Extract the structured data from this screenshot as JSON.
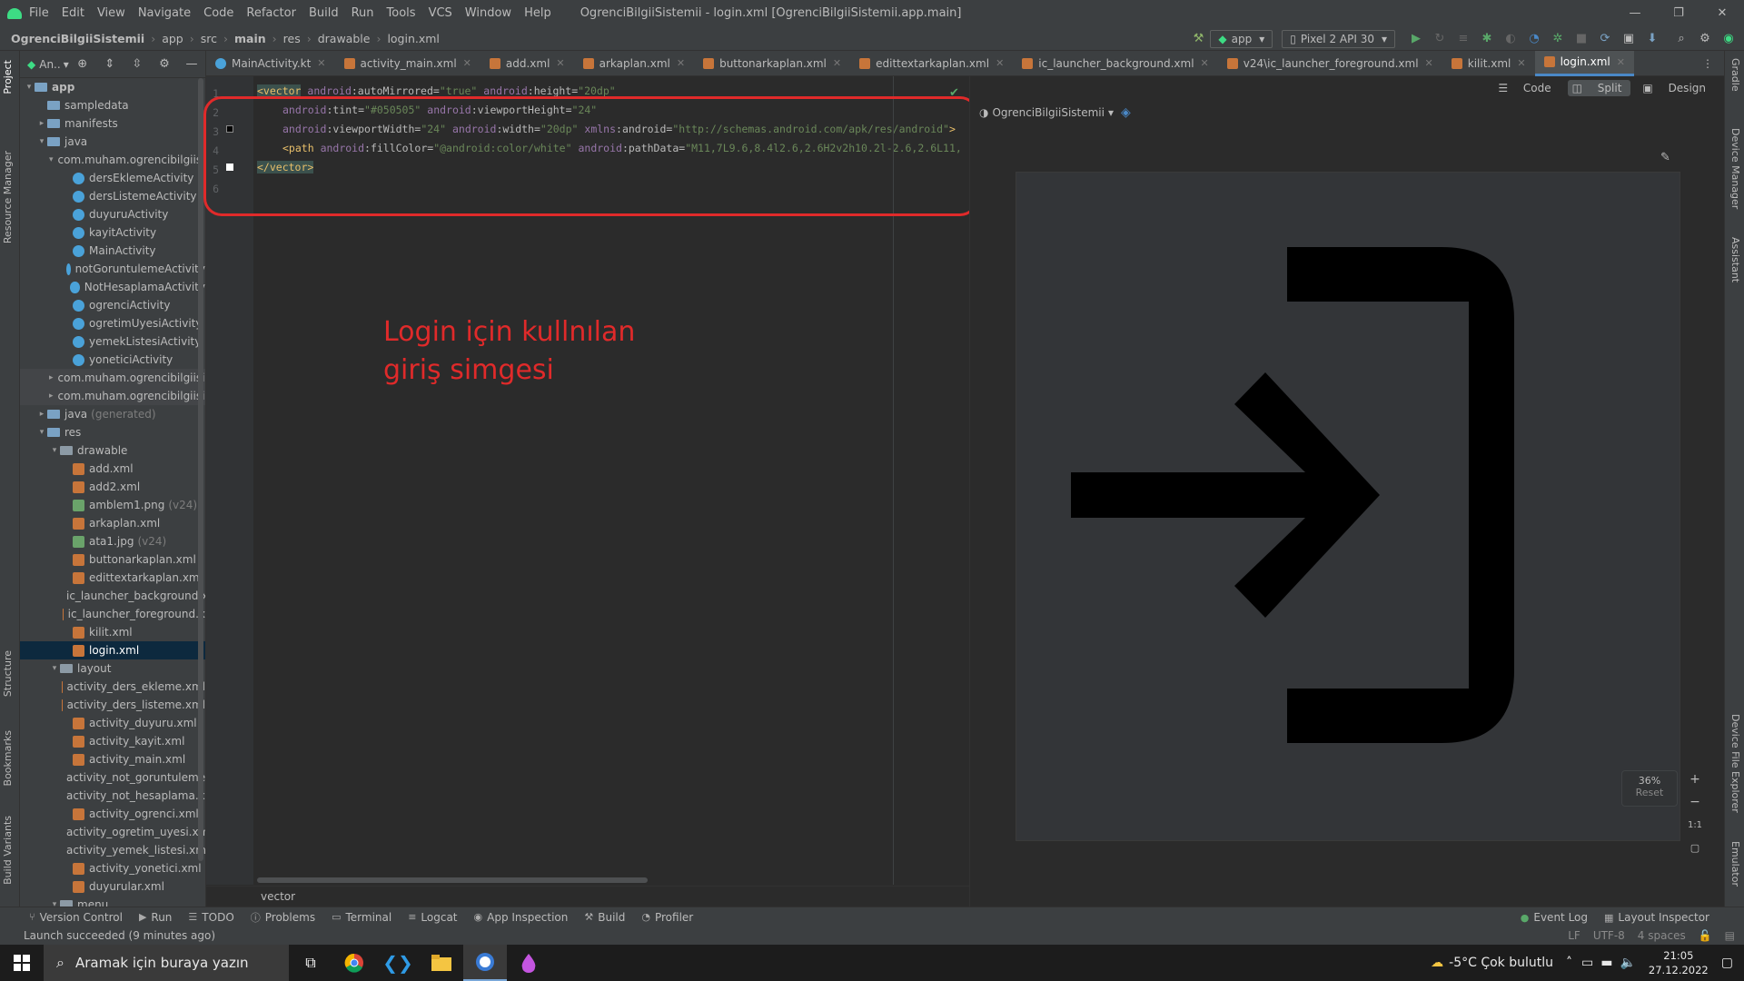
{
  "titlebar": {
    "menu": [
      "File",
      "Edit",
      "View",
      "Navigate",
      "Code",
      "Refactor",
      "Build",
      "Run",
      "Tools",
      "VCS",
      "Window",
      "Help"
    ],
    "title": "OgrenciBilgiiSistemii - login.xml [OgrenciBilgiiSistemii.app.main]"
  },
  "navbar": {
    "breadcrumb": [
      "OgrenciBilgiiSistemii",
      "app",
      "src",
      "main",
      "res",
      "drawable",
      "login.xml"
    ],
    "run_config": "app",
    "device": "Pixel 2 API 30"
  },
  "project": {
    "view_label": "An..",
    "tree": [
      {
        "label": "app",
        "indent": 0,
        "type": "folder",
        "arrow": "▾",
        "bold": true
      },
      {
        "label": "sampledata",
        "indent": 1,
        "type": "folder",
        "arrow": ""
      },
      {
        "label": "manifests",
        "indent": 1,
        "type": "folder",
        "arrow": "▸"
      },
      {
        "label": "java",
        "indent": 1,
        "type": "folder",
        "arrow": "▾"
      },
      {
        "label": "com.muham.ogrencibilgiisist",
        "indent": 2,
        "type": "folder",
        "arrow": "▾"
      },
      {
        "label": "dersEklemeActivity",
        "indent": 3,
        "type": "kt",
        "arrow": ""
      },
      {
        "label": "dersListemeActivity",
        "indent": 3,
        "type": "kt",
        "arrow": ""
      },
      {
        "label": "duyuruActivity",
        "indent": 3,
        "type": "kt",
        "arrow": ""
      },
      {
        "label": "kayitActivity",
        "indent": 3,
        "type": "kt",
        "arrow": ""
      },
      {
        "label": "MainActivity",
        "indent": 3,
        "type": "kt",
        "arrow": ""
      },
      {
        "label": "notGoruntulemeActivity",
        "indent": 3,
        "type": "kt",
        "arrow": ""
      },
      {
        "label": "NotHesaplamaActivity",
        "indent": 3,
        "type": "kt",
        "arrow": ""
      },
      {
        "label": "ogrenciActivity",
        "indent": 3,
        "type": "kt",
        "arrow": ""
      },
      {
        "label": "ogretimUyesiActivity",
        "indent": 3,
        "type": "kt",
        "arrow": ""
      },
      {
        "label": "yemekListesiActivity",
        "indent": 3,
        "type": "kt",
        "arrow": ""
      },
      {
        "label": "yoneticiActivity",
        "indent": 3,
        "type": "kt",
        "arrow": ""
      },
      {
        "label": "com.muham.ogrencibilgiisist",
        "indent": 2,
        "type": "folder",
        "arrow": "▸",
        "grp": true
      },
      {
        "label": "com.muham.ogrencibilgiisist",
        "indent": 2,
        "type": "folder",
        "arrow": "▸",
        "grp": true
      },
      {
        "label": "java",
        "indent": 1,
        "type": "folder",
        "arrow": "▸",
        "dim": "(generated)"
      },
      {
        "label": "res",
        "indent": 1,
        "type": "folder",
        "arrow": "▾"
      },
      {
        "label": "drawable",
        "indent": 2,
        "type": "folder",
        "arrow": "▾"
      },
      {
        "label": "add.xml",
        "indent": 3,
        "type": "xml",
        "arrow": ""
      },
      {
        "label": "add2.xml",
        "indent": 3,
        "type": "xml",
        "arrow": ""
      },
      {
        "label": "amblem1.png",
        "indent": 3,
        "type": "img",
        "arrow": "",
        "dim": "(v24)"
      },
      {
        "label": "arkaplan.xml",
        "indent": 3,
        "type": "xml",
        "arrow": ""
      },
      {
        "label": "ata1.jpg",
        "indent": 3,
        "type": "img",
        "arrow": "",
        "dim": "(v24)"
      },
      {
        "label": "buttonarkaplan.xml",
        "indent": 3,
        "type": "xml",
        "arrow": ""
      },
      {
        "label": "edittextarkaplan.xml",
        "indent": 3,
        "type": "xml",
        "arrow": ""
      },
      {
        "label": "ic_launcher_background.x",
        "indent": 3,
        "type": "xml",
        "arrow": ""
      },
      {
        "label": "ic_launcher_foreground.x",
        "indent": 3,
        "type": "xml",
        "arrow": ""
      },
      {
        "label": "kilit.xml",
        "indent": 3,
        "type": "xml",
        "arrow": ""
      },
      {
        "label": "login.xml",
        "indent": 3,
        "type": "xml",
        "arrow": "",
        "sel": true
      },
      {
        "label": "layout",
        "indent": 2,
        "type": "folder",
        "arrow": "▾"
      },
      {
        "label": "activity_ders_ekleme.xml",
        "indent": 3,
        "type": "xml",
        "arrow": ""
      },
      {
        "label": "activity_ders_listeme.xml",
        "indent": 3,
        "type": "xml",
        "arrow": ""
      },
      {
        "label": "activity_duyuru.xml",
        "indent": 3,
        "type": "xml",
        "arrow": ""
      },
      {
        "label": "activity_kayit.xml",
        "indent": 3,
        "type": "xml",
        "arrow": ""
      },
      {
        "label": "activity_main.xml",
        "indent": 3,
        "type": "xml",
        "arrow": ""
      },
      {
        "label": "activity_not_goruntuleme",
        "indent": 3,
        "type": "xml",
        "arrow": ""
      },
      {
        "label": "activity_not_hesaplama.xr",
        "indent": 3,
        "type": "xml",
        "arrow": ""
      },
      {
        "label": "activity_ogrenci.xml",
        "indent": 3,
        "type": "xml",
        "arrow": ""
      },
      {
        "label": "activity_ogretim_uyesi.xm",
        "indent": 3,
        "type": "xml",
        "arrow": ""
      },
      {
        "label": "activity_yemek_listesi.xml",
        "indent": 3,
        "type": "xml",
        "arrow": ""
      },
      {
        "label": "activity_yonetici.xml",
        "indent": 3,
        "type": "xml",
        "arrow": ""
      },
      {
        "label": "duyurular.xml",
        "indent": 3,
        "type": "xml",
        "arrow": ""
      },
      {
        "label": "menu",
        "indent": 2,
        "type": "folder",
        "arrow": "▾"
      }
    ]
  },
  "tabs": [
    {
      "label": "MainActivity.kt",
      "kt": true
    },
    {
      "label": "activity_main.xml"
    },
    {
      "label": "add.xml"
    },
    {
      "label": "arkaplan.xml"
    },
    {
      "label": "buttonarkaplan.xml"
    },
    {
      "label": "edittextarkaplan.xml"
    },
    {
      "label": "ic_launcher_background.xml"
    },
    {
      "label": "v24\\ic_launcher_foreground.xml"
    },
    {
      "label": "kilit.xml"
    },
    {
      "label": "login.xml",
      "active": true
    }
  ],
  "editor": {
    "line_numbers": [
      "1",
      "2",
      "3",
      "4",
      "5",
      "6"
    ],
    "line1": {
      "open": "<vector",
      "a1": "android",
      "a1n": ":autoMirrored=",
      "a1v": "\"true\"",
      "a2": "android",
      "a2n": ":height=",
      "a2v": "\"20dp\""
    },
    "line2": {
      "a1": "android",
      "a1n": ":tint=",
      "a1v": "\"#050505\"",
      "a2": "android",
      "a2n": ":viewportHeight=",
      "a2v": "\"24\""
    },
    "line3": {
      "a1": "android",
      "a1n": ":viewportWidth=",
      "a1v": "\"24\"",
      "a2": "android",
      "a2n": ":width=",
      "a2v": "\"20dp\"",
      "a3": "xmlns",
      "a3n": ":android=",
      "a3v": "\"http://schemas.android.com/apk/res/android\"",
      "close": ">"
    },
    "line4": {
      "open": "<path",
      "a1": "android",
      "a1n": ":fillColor=",
      "a1v": "\"@android:color/white\"",
      "a2": "android",
      "a2n": ":pathData=",
      "a2v": "\"M11,7L9.6,8.4l2.6,2.6H2v2h10.2l-2.6,2.6L11,"
    },
    "line5": {
      "close": "</vector>"
    },
    "annotation": [
      "Login için kullnılan",
      "giriş simgesi"
    ],
    "breadcrumb": "vector"
  },
  "design": {
    "modes": [
      "Code",
      "Split",
      "Design"
    ],
    "theme_label": "OgrenciBilgiiSistemii",
    "zoom": "36%",
    "reset": "Reset",
    "one_to_one": "1:1"
  },
  "left_strip": [
    "Project",
    "Resource Manager",
    "Structure",
    "Bookmarks",
    "Build Variants"
  ],
  "right_strip": [
    "Gradle",
    "Device Manager",
    "Assistant",
    "Device File Explorer",
    "Emulator"
  ],
  "bottom_tools": [
    "Version Control",
    "Run",
    "TODO",
    "Problems",
    "Terminal",
    "Logcat",
    "App Inspection",
    "Build",
    "Profiler"
  ],
  "bottom_right": [
    "Event Log",
    "Layout Inspector"
  ],
  "status": {
    "message": "Launch succeeded (9 minutes ago)",
    "right": [
      "LF",
      "UTF-8",
      "4 spaces"
    ]
  },
  "taskbar": {
    "search_placeholder": "Aramak için buraya yazın",
    "weather": "-5°C  Çok bulutlu",
    "time": "21:05",
    "date": "27.12.2022"
  },
  "colors": {
    "accent": "#4a88c7",
    "annotation_red": "#e02a2a",
    "android_green": "#3ddc84"
  }
}
